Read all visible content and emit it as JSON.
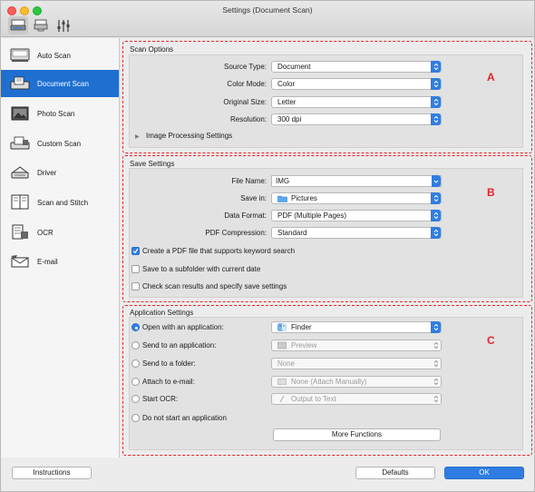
{
  "window": {
    "title": "Settings (Document Scan)"
  },
  "toolbar": {
    "icons": [
      "scan-settings-icon",
      "scanner-icon",
      "general-settings-icon"
    ]
  },
  "sidebar": {
    "items": [
      {
        "label": "Auto Scan",
        "icon": "auto-scan-icon"
      },
      {
        "label": "Document Scan",
        "icon": "document-scan-icon",
        "selected": true
      },
      {
        "label": "Photo Scan",
        "icon": "photo-scan-icon"
      },
      {
        "label": "Custom Scan",
        "icon": "custom-scan-icon"
      },
      {
        "label": "Driver",
        "icon": "driver-icon"
      },
      {
        "label": "Scan and Stitch",
        "icon": "scan-stitch-icon"
      },
      {
        "label": "OCR",
        "icon": "ocr-icon"
      },
      {
        "label": "E-mail",
        "icon": "email-icon"
      }
    ]
  },
  "scan_options": {
    "title": "Scan Options",
    "source_type": {
      "label": "Source Type:",
      "value": "Document"
    },
    "color_mode": {
      "label": "Color Mode:",
      "value": "Color"
    },
    "original_size": {
      "label": "Original Size:",
      "value": "Letter"
    },
    "resolution": {
      "label": "Resolution:",
      "value": "300 dpi"
    },
    "image_processing": "Image Processing Settings"
  },
  "save_settings": {
    "title": "Save Settings",
    "file_name": {
      "label": "File Name:",
      "value": "IMG"
    },
    "save_in": {
      "label": "Save in:",
      "value": "Pictures"
    },
    "data_format": {
      "label": "Data Format:",
      "value": "PDF (Multiple Pages)"
    },
    "pdf_compression": {
      "label": "PDF Compression:",
      "value": "Standard"
    },
    "checkbox_keyword": {
      "label": "Create a PDF file that supports keyword search",
      "checked": true
    },
    "checkbox_subfolder": {
      "label": "Save to a subfolder with current date",
      "checked": false
    },
    "checkbox_check_results": {
      "label": "Check scan results and specify save settings",
      "checked": false
    }
  },
  "application_settings": {
    "title": "Application Settings",
    "open_with_app": {
      "label": "Open with an application:",
      "value": "Finder",
      "checked": true
    },
    "send_to_app": {
      "label": "Send to an application:",
      "value": "Preview"
    },
    "send_to_folder": {
      "label": "Send to a folder:",
      "value": "None"
    },
    "attach_email": {
      "label": "Attach to e-mail:",
      "value": "None (Attach Manually)"
    },
    "start_ocr": {
      "label": "Start OCR:",
      "value": "Output to Text"
    },
    "do_not_start": {
      "label": "Do not start an application"
    },
    "more_functions": "More Functions"
  },
  "callouts": {
    "a": "A",
    "b": "B",
    "c": "C"
  },
  "footer": {
    "instructions": "Instructions",
    "defaults": "Defaults",
    "ok": "OK"
  },
  "colors": {
    "accent": "#2f7de3",
    "selection": "#1f6fd1",
    "callout": "#e4262a"
  }
}
